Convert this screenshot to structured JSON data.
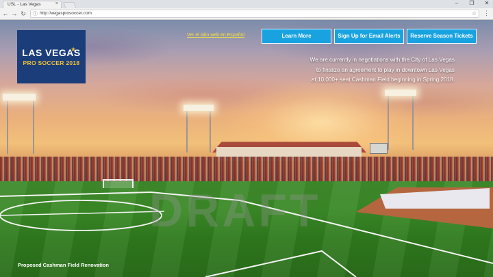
{
  "browser": {
    "tab_title": "USL - Las Vegas",
    "tab_close_icon": "close-icon",
    "url": "http://vegasprosoccer.com",
    "icons": {
      "back": "back-arrow-icon",
      "forward": "forward-arrow-icon",
      "reload": "reload-icon",
      "page_info": "info-icon",
      "bookmark": "star-icon",
      "menu": "kebab-menu-icon"
    },
    "window_controls": {
      "minimize": "–",
      "maximize": "❐",
      "close": "✕"
    }
  },
  "page": {
    "logo": {
      "line1": "LAS VEGAS",
      "line2": "PRO SOCCER 2018"
    },
    "spanish_link": "Ver el sitio web en Español",
    "buttons": {
      "learn_more": "Learn More",
      "email_alerts": "Sign Up for Email Alerts",
      "season_tickets": "Reserve Season Tickets"
    },
    "announcement": [
      "We are currently in negotiations with the City of Las Vegas",
      "to finalize an agreement to play in downtown Las Vegas",
      "at 10,000+ seat Cashman Field beginning in Spring 2018."
    ],
    "watermark": "DRAFT",
    "caption": "Proposed Cashman Field Renovation"
  },
  "colors": {
    "button_bg": "#18a2e0",
    "logo_bg": "#1b3d7a",
    "logo_accent": "#f2c23a",
    "link": "#f4e23a"
  }
}
